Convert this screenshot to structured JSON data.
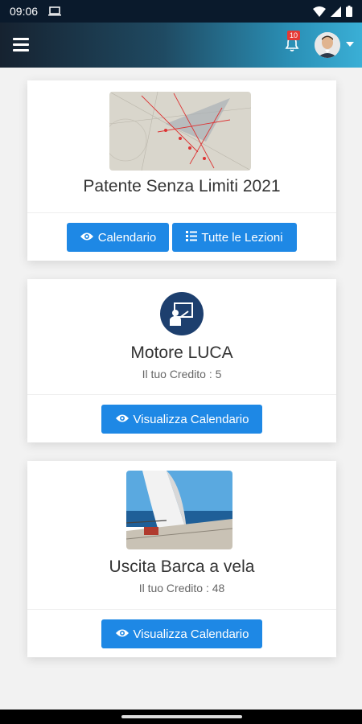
{
  "status_bar": {
    "time": "09:06"
  },
  "app_bar": {
    "notification_count": "10"
  },
  "cards": [
    {
      "title": "Patente Senza Limiti 2021",
      "buttons": [
        "Calendario",
        "Tutte le Lezioni"
      ]
    },
    {
      "title": "Motore LUCA",
      "credit": "Il tuo Credito : 5",
      "button": "Visualizza Calendario"
    },
    {
      "title": "Uscita Barca a vela",
      "credit": "Il tuo Credito : 48",
      "button": "Visualizza Calendario"
    }
  ],
  "colors": {
    "primary_button": "#1e88e5",
    "icon_circle": "#1d3f6e",
    "badge": "#e53935"
  }
}
